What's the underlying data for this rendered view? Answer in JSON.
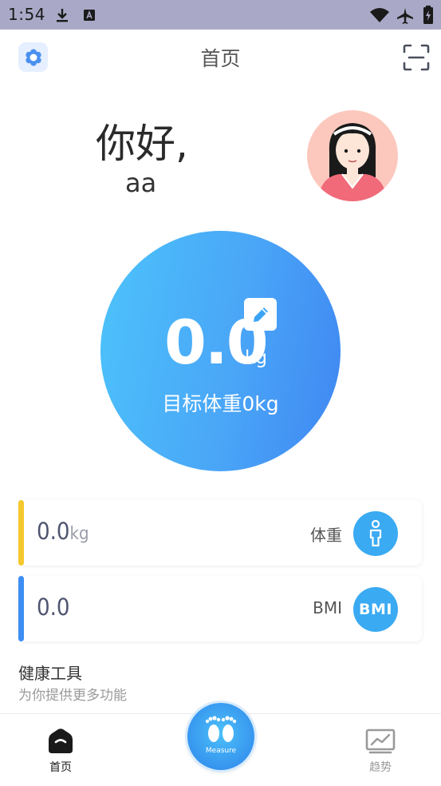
{
  "status_bar": {
    "time": "1:54"
  },
  "header": {
    "title": "首页"
  },
  "greeting": {
    "title": "你好,",
    "name": "aa"
  },
  "weight_circle": {
    "value": "0.0",
    "unit": "kg",
    "target_text": "目标体重0kg"
  },
  "cards": [
    {
      "value": "0.0",
      "unit": "kg",
      "label": "体重",
      "accent": "#f5c92e",
      "icon": "person-icon"
    },
    {
      "value": "0.0",
      "unit": "",
      "label": "BMI",
      "accent": "#3d8ef3",
      "icon_text": "BMI"
    }
  ],
  "health_tools": {
    "title": "健康工具",
    "subtitle": "为你提供更多功能"
  },
  "bottom_nav": {
    "home_label": "首页",
    "measure_label": "Measure",
    "trend_label": "趋势"
  },
  "colors": {
    "primary": "#3aaaf2",
    "gradient_start": "#4cc3fb",
    "gradient_end": "#3f87f2"
  }
}
